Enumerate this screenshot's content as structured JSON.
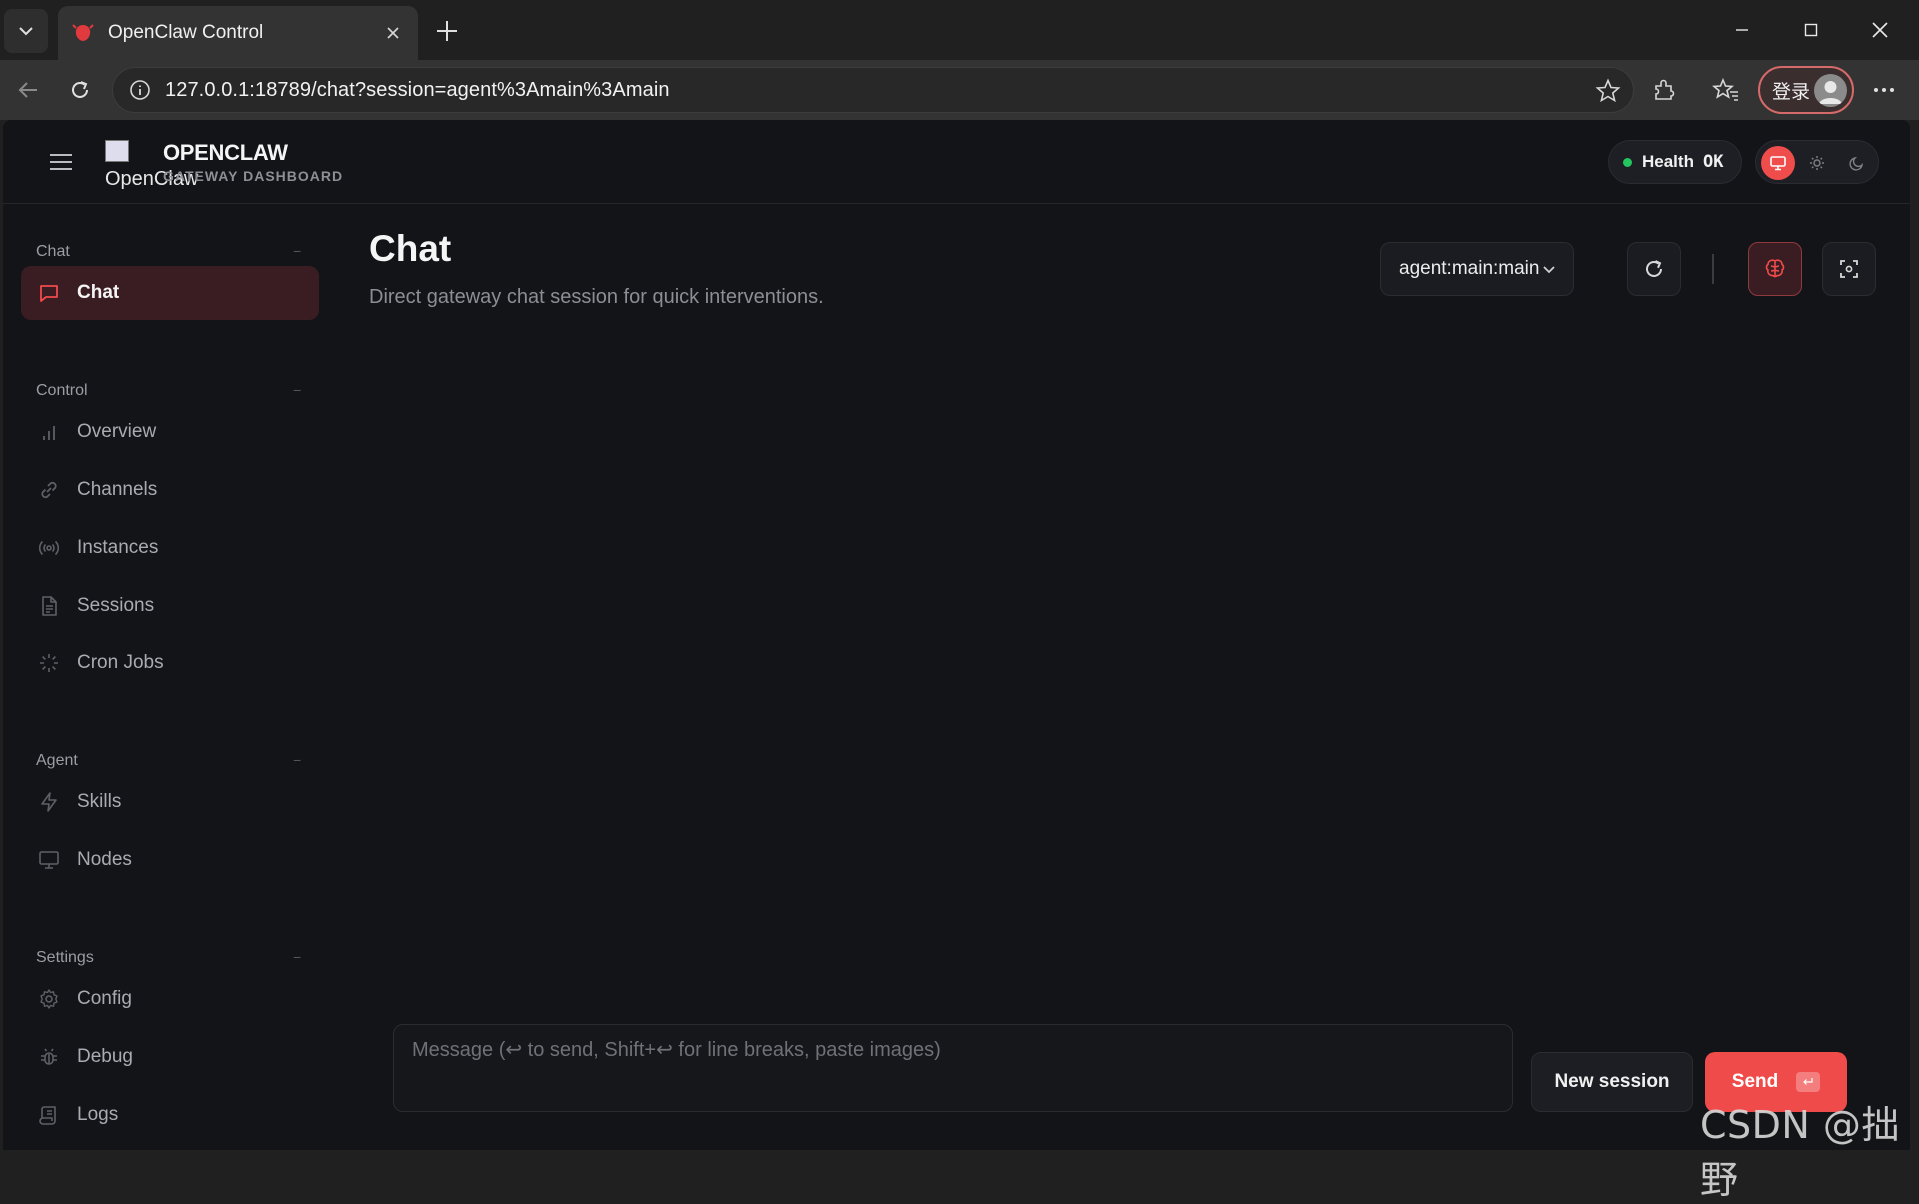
{
  "browser": {
    "tab_title": "OpenClaw Control",
    "url": "127.0.0.1:18789/chat?session=agent%3Amain%3Amain",
    "login_label": "登录"
  },
  "header": {
    "logo_alt": "OpenClaw",
    "title": "OPENCLAW",
    "subtitle": "GATEWAY DASHBOARD",
    "health_label": "Health",
    "health_value": "OK"
  },
  "sidebar": {
    "sections": [
      {
        "label": "Chat",
        "collapse": "−"
      },
      {
        "label": "Control",
        "collapse": "−"
      },
      {
        "label": "Agent",
        "collapse": "−"
      },
      {
        "label": "Settings",
        "collapse": "−"
      }
    ],
    "items": [
      {
        "label": "Chat",
        "icon": "message-square-icon",
        "active": true
      },
      {
        "label": "Overview",
        "icon": "bar-chart-icon"
      },
      {
        "label": "Channels",
        "icon": "link-icon"
      },
      {
        "label": "Instances",
        "icon": "radio-icon"
      },
      {
        "label": "Sessions",
        "icon": "file-text-icon"
      },
      {
        "label": "Cron Jobs",
        "icon": "loader-icon"
      },
      {
        "label": "Skills",
        "icon": "zap-icon"
      },
      {
        "label": "Nodes",
        "icon": "monitor-icon"
      },
      {
        "label": "Config",
        "icon": "settings-icon"
      },
      {
        "label": "Debug",
        "icon": "bug-icon"
      },
      {
        "label": "Logs",
        "icon": "scroll-icon"
      }
    ]
  },
  "main": {
    "title": "Chat",
    "subtitle": "Direct gateway chat session for quick interventions.",
    "session_value": "agent:main:main",
    "composer_placeholder": "Message (↩ to send, Shift+↩ for line breaks, paste images)",
    "new_session_label": "New session",
    "send_label": "Send"
  },
  "watermark": "CSDN @拙野",
  "colors": {
    "accent": "#f04b4b",
    "app_bg": "#131418",
    "active_nav_bg": "#3a1d22",
    "health_ok": "#22c55e"
  }
}
